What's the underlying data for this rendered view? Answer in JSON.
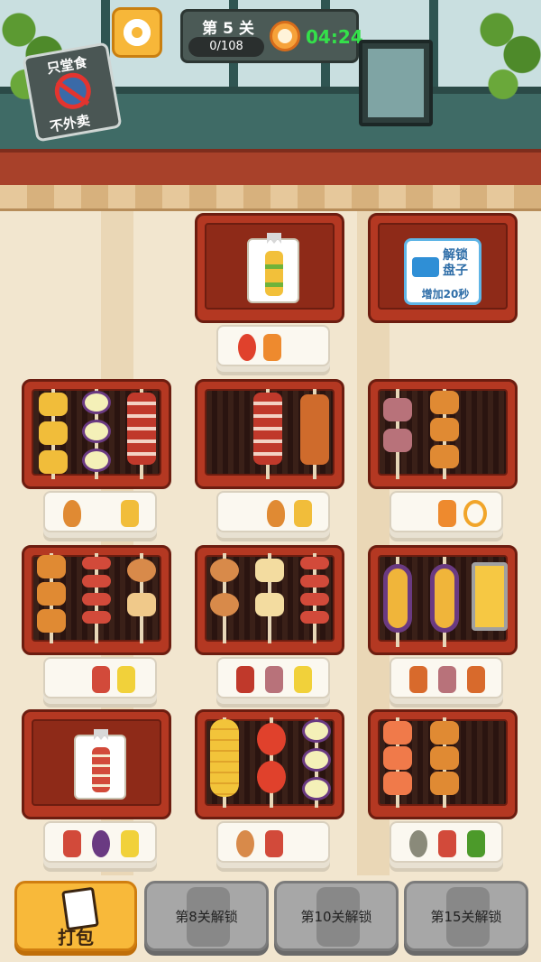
{
  "hud": {
    "level_label": "第 5 关",
    "progress_text": "0/108",
    "timer": "04:24"
  },
  "sign": {
    "line1": "只堂食",
    "line2": "不外卖"
  },
  "unlock_plate": {
    "line1": "解锁",
    "line2": "盘子",
    "bonus": "增加20秒"
  },
  "bottom_bar": {
    "pack_label": "打包",
    "lock1_label": "第8关解锁",
    "lock2_label": "第10关解锁",
    "lock3_label": "第15关解锁"
  },
  "colors": {
    "grill": "#b43822",
    "button_orange": "#f8b93a",
    "timer_green": "#34e14a"
  }
}
